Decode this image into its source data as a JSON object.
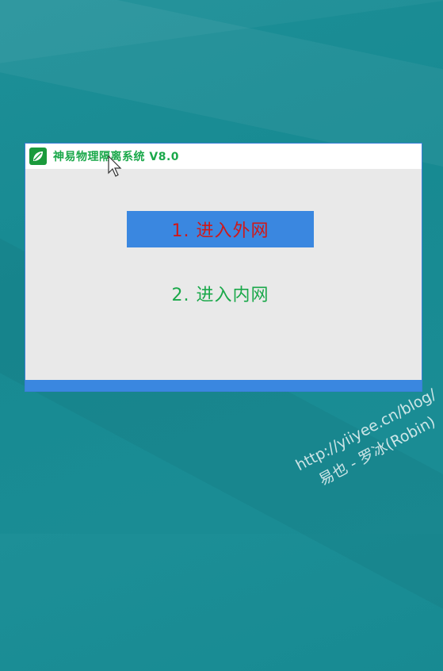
{
  "window": {
    "title": "神易物理隔离系统  V8.0",
    "menu": [
      {
        "label": "1.  进入外网",
        "selected": true
      },
      {
        "label": "2.  进入内网",
        "selected": false
      }
    ]
  },
  "watermark": {
    "line1": "http://yiiyee.cn/blog/",
    "line2": "易也 - 罗冰(Robin)"
  },
  "colors": {
    "desktop": "#178a92",
    "window_bg": "#e9e9e9",
    "accent_blue": "#3a87e0",
    "title_green": "#1aa84a",
    "selected_text_red": "#d01818"
  },
  "icons": [
    "leaf-icon",
    "mouse-cursor-icon"
  ]
}
